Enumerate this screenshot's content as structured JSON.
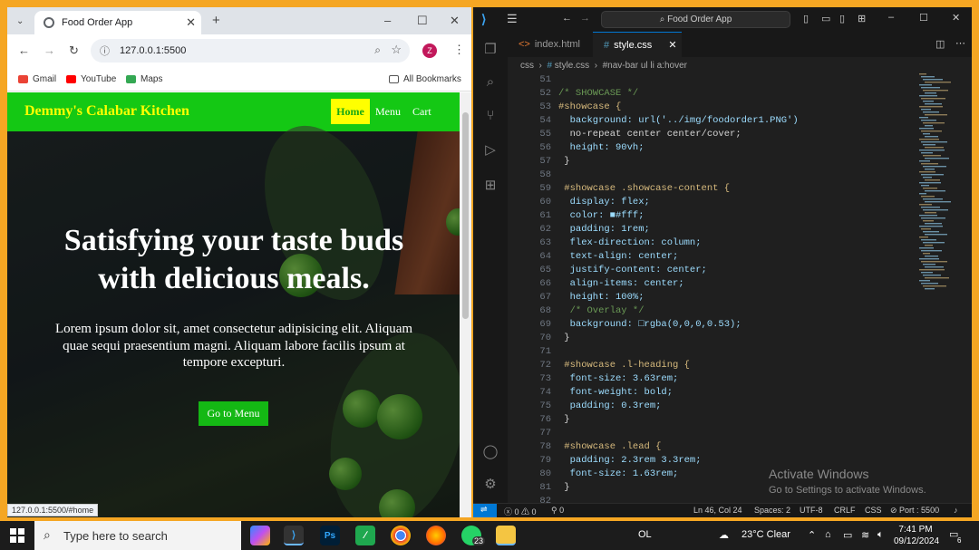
{
  "browser": {
    "tab_title": "Food Order App",
    "url": "127.0.0.1:5500",
    "profile_initial": "Z",
    "bookmarks": [
      "Gmail",
      "YouTube",
      "Maps"
    ],
    "all_bookmarks": "All Bookmarks",
    "status_url": "127.0.0.1:5500/#home"
  },
  "site": {
    "brand": "Demmy's Calabar Kitchen",
    "nav": [
      "Home",
      "Menu",
      "Cart"
    ],
    "heading_line1": "Satisfying your taste buds",
    "heading_line2": "with delicious meals.",
    "lead": "Lorem ipsum dolor sit, amet consectetur adipisicing elit. Aliquam quae sequi praesentium magni. Aliquam labore facilis ipsum at tempore excepturi.",
    "button": "Go to Menu"
  },
  "vscode": {
    "search": "Food Order App",
    "tabs": [
      "index.html",
      "style.css"
    ],
    "breadcrumb": [
      "css",
      "style.css",
      "#nav-bar ul li a:hover"
    ],
    "lines": [
      {
        "n": "51",
        "t": ""
      },
      {
        "n": "52",
        "t": "/* SHOWCASE */"
      },
      {
        "n": "53",
        "t": "#showcase {"
      },
      {
        "n": "54",
        "t": "  background: url('../img/foodorder1.PNG')"
      },
      {
        "n": "55",
        "t": "  no-repeat center center/cover;"
      },
      {
        "n": "56",
        "t": "  height: 90vh;"
      },
      {
        "n": "57",
        "t": " }"
      },
      {
        "n": "58",
        "t": ""
      },
      {
        "n": "59",
        "t": " #showcase .showcase-content {"
      },
      {
        "n": "60",
        "t": "  display: flex;"
      },
      {
        "n": "61",
        "t": "  color: ■#fff;"
      },
      {
        "n": "62",
        "t": "  padding: 1rem;"
      },
      {
        "n": "63",
        "t": "  flex-direction: column;"
      },
      {
        "n": "64",
        "t": "  text-align: center;"
      },
      {
        "n": "65",
        "t": "  justify-content: center;"
      },
      {
        "n": "66",
        "t": "  align-items: center;"
      },
      {
        "n": "67",
        "t": "  height: 100%;"
      },
      {
        "n": "68",
        "t": "  /* Overlay */"
      },
      {
        "n": "69",
        "t": "  background: □rgba(0,0,0,0.53);"
      },
      {
        "n": "70",
        "t": " }"
      },
      {
        "n": "71",
        "t": ""
      },
      {
        "n": "72",
        "t": " #showcase .l-heading {"
      },
      {
        "n": "73",
        "t": "  font-size: 3.63rem;"
      },
      {
        "n": "74",
        "t": "  font-weight: bold;"
      },
      {
        "n": "75",
        "t": "  padding: 0.3rem;"
      },
      {
        "n": "76",
        "t": " }"
      },
      {
        "n": "77",
        "t": ""
      },
      {
        "n": "78",
        "t": " #showcase .lead {"
      },
      {
        "n": "79",
        "t": "  padding: 2.3rem 3.3rem;"
      },
      {
        "n": "80",
        "t": "  font-size: 1.63rem;"
      },
      {
        "n": "81",
        "t": " }"
      },
      {
        "n": "82",
        "t": ""
      }
    ],
    "activate_title": "Activate Windows",
    "activate_sub": "Go to Settings to activate Windows.",
    "status": {
      "errors": "0",
      "warnings": "0",
      "ports": "0",
      "position": "Ln 46, Col 24",
      "spaces": "Spaces: 2",
      "encoding": "UTF-8",
      "eol": "CRLF",
      "language": "CSS",
      "port": "Port : 5500"
    }
  },
  "taskbar": {
    "search_placeholder": "Type here to search",
    "whatsapp_badge": "23",
    "ol": "OL",
    "weather": "23°C  Clear",
    "time": "7:41 PM",
    "date": "09/12/2024",
    "notif": "6"
  }
}
